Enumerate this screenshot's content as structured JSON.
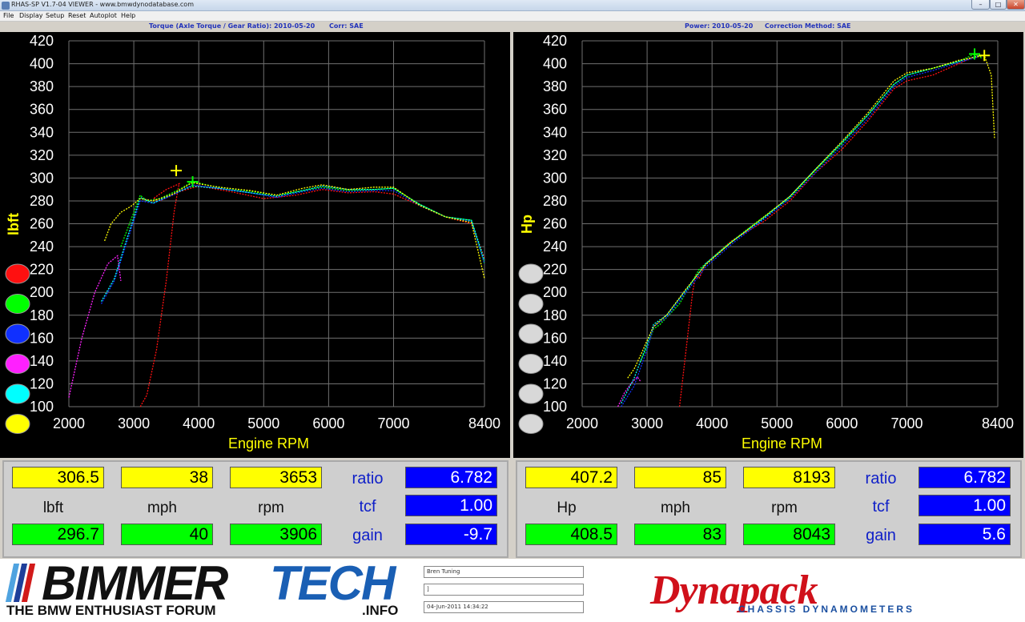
{
  "window": {
    "title": "RHAS-SP V1.7-04  VIEWER - www.bmwdynodatabase.com",
    "minimize": "–",
    "maximize": "□",
    "close": "✕"
  },
  "menu": [
    "File",
    "Display",
    "Setup",
    "Reset",
    "Autoplot",
    "Help"
  ],
  "colors": {
    "run_red": "#ff1010",
    "run_green": "#00ff00",
    "run_blue": "#1030ff",
    "run_magenta": "#ff20ff",
    "run_cyan": "#00ffff",
    "run_yellow": "#ffff00",
    "axis_text": "#ffffff",
    "axis_label": "#ffff00",
    "grid": "#707070"
  },
  "torque": {
    "header": "Torque (Axle Torque / Gear Ratio): 2010-05-20",
    "corr": "Corr: SAE",
    "readout": {
      "cursor1": [
        "306.5",
        "38",
        "3653"
      ],
      "units": [
        "lbft",
        "mph",
        "rpm"
      ],
      "cursor2": [
        "296.7",
        "40",
        "3906"
      ],
      "labels": [
        "ratio",
        "tcf",
        "gain"
      ],
      "values": [
        "6.782",
        "1.00",
        "-9.7"
      ]
    }
  },
  "power": {
    "header": "Power: 2010-05-20",
    "corr": "Correction Method: SAE",
    "readout": {
      "cursor1": [
        "407.2",
        "85",
        "8193"
      ],
      "units": [
        "Hp",
        "mph",
        "rpm"
      ],
      "cursor2": [
        "408.5",
        "83",
        "8043"
      ],
      "labels": [
        "ratio",
        "tcf",
        "gain"
      ],
      "values": [
        "6.782",
        "1.00",
        "5.6"
      ]
    }
  },
  "chart_data": [
    {
      "type": "line",
      "title": "",
      "xlabel": "Engine RPM",
      "ylabel": "lbft",
      "xlim": [
        2000,
        8400
      ],
      "ylim": [
        100,
        420
      ],
      "xticks": [
        2000,
        3000,
        4000,
        5000,
        6000,
        7000,
        8400
      ],
      "yticks": [
        100,
        120,
        140,
        160,
        180,
        200,
        220,
        240,
        260,
        280,
        300,
        320,
        340,
        360,
        380,
        400,
        420
      ],
      "grid": true,
      "cursors": [
        {
          "x": 3653,
          "y": 306.5,
          "color": "#ffff00"
        },
        {
          "x": 3906,
          "y": 296.7,
          "color": "#00ff00"
        }
      ],
      "series": [
        {
          "color": "#ff1010",
          "x": [
            3100,
            3200,
            3350,
            3500,
            3620,
            3680,
            3700,
            3500,
            3300,
            3400,
            3700,
            4000,
            4500,
            5000,
            5500,
            5900,
            6300,
            6700,
            7000,
            7400,
            7800,
            8200,
            8400
          ],
          "y": [
            100,
            110,
            150,
            210,
            270,
            290,
            295,
            290,
            282,
            280,
            288,
            293,
            288,
            282,
            285,
            290,
            287,
            288,
            286,
            276,
            266,
            260,
            230
          ]
        },
        {
          "color": "#00ff00",
          "x": [
            2800,
            3000,
            3100,
            3200,
            3400,
            3700,
            3906,
            4200,
            4700,
            5200,
            5600,
            5900,
            6300,
            6700,
            7000,
            7400,
            7800,
            8200,
            8400
          ],
          "y": [
            240,
            270,
            285,
            280,
            282,
            290,
            297,
            293,
            289,
            285,
            289,
            292,
            289,
            290,
            291,
            277,
            266,
            263,
            225
          ]
        },
        {
          "color": "#1030ff",
          "x": [
            2500,
            2700,
            2900,
            3100,
            3300,
            3600,
            3900,
            4300,
            4800,
            5200,
            5600,
            5900,
            6300,
            6700,
            7000,
            7400,
            7800,
            8200,
            8400
          ],
          "y": [
            190,
            210,
            245,
            280,
            278,
            285,
            294,
            291,
            287,
            283,
            288,
            291,
            288,
            289,
            289,
            276,
            266,
            262,
            225
          ]
        },
        {
          "color": "#ff20ff",
          "x": [
            2000,
            2200,
            2400,
            2600,
            2750,
            2800
          ],
          "y": [
            108,
            160,
            200,
            225,
            232,
            210
          ]
        },
        {
          "color": "#00ffff",
          "x": [
            2500,
            2700,
            2900,
            3100,
            3300,
            3600,
            3900,
            4300,
            4800,
            5200,
            5600,
            5900,
            6300,
            6700,
            7000,
            7400,
            7800,
            8200,
            8400
          ],
          "y": [
            192,
            212,
            248,
            283,
            278,
            286,
            293,
            291,
            287,
            284,
            289,
            293,
            290,
            290,
            291,
            277,
            266,
            263,
            228
          ]
        },
        {
          "color": "#ffff00",
          "x": [
            2550,
            2650,
            2800,
            2950,
            3100,
            3300,
            3600,
            3900,
            4300,
            4800,
            5200,
            5600,
            5900,
            6300,
            6700,
            7000,
            7400,
            7800,
            8200,
            8400
          ],
          "y": [
            245,
            260,
            270,
            275,
            282,
            280,
            286,
            296,
            292,
            289,
            285,
            291,
            294,
            290,
            292,
            292,
            276,
            266,
            261,
            212
          ]
        }
      ]
    },
    {
      "type": "line",
      "title": "",
      "xlabel": "Engine RPM",
      "ylabel": "Hp",
      "xlim": [
        2000,
        8400
      ],
      "ylim": [
        100,
        420
      ],
      "xticks": [
        2000,
        3000,
        4000,
        5000,
        6000,
        7000,
        8400
      ],
      "yticks": [
        100,
        120,
        140,
        160,
        180,
        200,
        220,
        240,
        260,
        280,
        300,
        320,
        340,
        360,
        380,
        400,
        420
      ],
      "grid": true,
      "cursors": [
        {
          "x": 8193,
          "y": 407.2,
          "color": "#ffff00"
        },
        {
          "x": 8043,
          "y": 408.5,
          "color": "#00ff00"
        }
      ],
      "series": [
        {
          "color": "#ff1010",
          "x": [
            3500,
            3600,
            3700,
            3750,
            3800,
            3900,
            4300,
            4800,
            5200,
            5600,
            6000,
            6400,
            6800,
            7000,
            7400,
            7800,
            8100
          ],
          "y": [
            100,
            150,
            200,
            215,
            212,
            225,
            245,
            262,
            280,
            305,
            325,
            350,
            378,
            385,
            390,
            400,
            408
          ]
        },
        {
          "color": "#00ff00",
          "x": [
            2900,
            3000,
            3100,
            3200,
            3500,
            3800,
            4200,
            4700,
            5200,
            5600,
            6000,
            6400,
            6800,
            7000,
            7400,
            7800,
            8043,
            8150
          ],
          "y": [
            140,
            152,
            168,
            172,
            190,
            220,
            240,
            262,
            283,
            307,
            330,
            355,
            382,
            390,
            396,
            402,
            408.5,
            405
          ]
        },
        {
          "color": "#1030ff",
          "x": [
            2600,
            2800,
            3000,
            3100,
            3300,
            3600,
            3900,
            4300,
            4800,
            5200,
            5600,
            6000,
            6400,
            6800,
            7000,
            7400,
            7800,
            8100
          ],
          "y": [
            100,
            118,
            150,
            170,
            178,
            200,
            222,
            242,
            264,
            282,
            305,
            328,
            352,
            380,
            388,
            394,
            401,
            406
          ]
        },
        {
          "color": "#ff20ff",
          "x": [
            2550,
            2650,
            2750,
            2850,
            2900
          ],
          "y": [
            100,
            112,
            120,
            126,
            122
          ]
        },
        {
          "color": "#00ffff",
          "x": [
            2600,
            2800,
            3000,
            3100,
            3300,
            3600,
            3900,
            4300,
            4800,
            5200,
            5600,
            6000,
            6400,
            6800,
            7000,
            7400,
            7800,
            8100
          ],
          "y": [
            103,
            125,
            155,
            172,
            180,
            202,
            225,
            244,
            265,
            284,
            308,
            331,
            355,
            382,
            390,
            396,
            402,
            407
          ]
        },
        {
          "color": "#ffff00",
          "x": [
            2700,
            2800,
            2900,
            3000,
            3100,
            3300,
            3600,
            3900,
            4300,
            4800,
            5200,
            5600,
            6000,
            6400,
            6800,
            7000,
            7400,
            7800,
            8193,
            8300,
            8350
          ],
          "y": [
            125,
            133,
            145,
            158,
            170,
            180,
            203,
            224,
            244,
            266,
            284,
            308,
            332,
            357,
            385,
            392,
            396,
            403,
            407.2,
            390,
            335
          ]
        }
      ]
    }
  ],
  "branding": {
    "left_brand_a": "BIMMER",
    "left_brand_b": "TECH",
    "left_tagline": "THE BMW ENTHUSIAST FORUM",
    "left_suffix": ".INFO",
    "right_brand": "Dynapack",
    "right_tagline": "CHASSIS DYNAMOMETERS",
    "info_fields": [
      "Bren Tuning",
      "]",
      "04-Jun-2011 14:34:22"
    ]
  }
}
